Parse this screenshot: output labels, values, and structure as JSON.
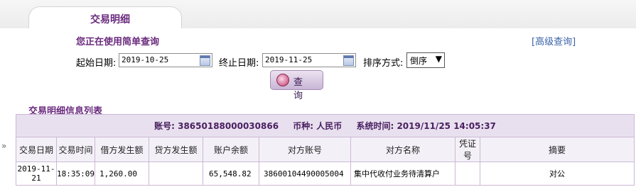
{
  "tab": {
    "label": "交易明细"
  },
  "query": {
    "mode_text": "您正在使用简单查询",
    "advanced_link": "[高级查询]",
    "start_label": "起始日期:",
    "start_value": "2019-10-25",
    "end_label": "终止日期:",
    "end_value": "2019-11-25",
    "sort_label": "排序方式:",
    "sort_value": "倒序",
    "query_button": "查 询"
  },
  "list": {
    "title": "交易明细信息列表",
    "account_label": "账号:",
    "account_value": "38650188000030866",
    "currency_label": "币种:",
    "currency_value": "人民币",
    "systime_label": "系统时间:",
    "systime_value": "2019/11/25 14:05:37",
    "expander": "»",
    "columns": [
      "交易日期",
      "交易时间",
      "借方发生额",
      "贷方发生额",
      "账户余额",
      "对方账号",
      "对方名称",
      "凭证号",
      "摘要"
    ],
    "rows": [
      {
        "date": "2019-11-21",
        "time": "18:35:09",
        "debit": "1,260.00",
        "credit": "",
        "balance": "65,548.82",
        "cp_account": "38600104490005004",
        "cp_name": "集中代收付业务待清算户",
        "voucher": "",
        "summary": "对公"
      }
    ]
  }
}
